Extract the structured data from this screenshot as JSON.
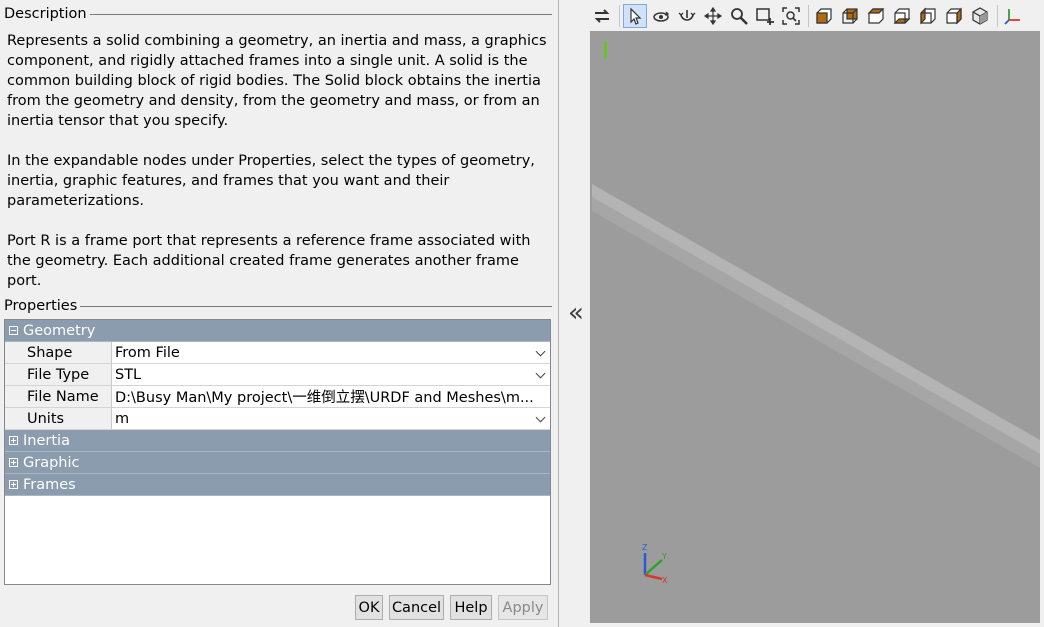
{
  "description": {
    "title": "Description",
    "paragraphs": [
      "Represents a solid combining a geometry, an inertia and mass, a graphics component, and rigidly attached frames into a single unit. A solid is the common building block of rigid bodies. The Solid block obtains the inertia from the geometry and density, from the geometry and mass, or from an inertia tensor that you specify.",
      "In the expandable nodes under Properties, select the types of geometry, inertia, graphic features, and frames that you want and their parameterizations.",
      "Port R is a frame port that represents a reference frame associated with the geometry. Each additional created frame generates another frame port."
    ]
  },
  "properties": {
    "title": "Properties",
    "geometry": {
      "label": "Geometry",
      "rows": [
        {
          "label": "Shape",
          "value": "From File"
        },
        {
          "label": "File Type",
          "value": "STL"
        },
        {
          "label": "File Name",
          "value": "D:\\Busy Man\\My project\\一维倒立摆\\URDF and Meshes\\m..."
        },
        {
          "label": "Units",
          "value": "m"
        }
      ]
    },
    "inertia": {
      "label": "Inertia"
    },
    "graphic": {
      "label": "Graphic"
    },
    "frames": {
      "label": "Frames"
    }
  },
  "buttons": {
    "ok": "OK",
    "cancel": "Cancel",
    "help": "Help",
    "apply": "Apply"
  },
  "triad": {
    "x": "X",
    "y": "Y",
    "z": "Z"
  },
  "colors": {
    "section_header": "#8a9cae",
    "viewport_background": "#9c9c9c",
    "solid_top": "#b4b4b4",
    "solid_side": "#a6a6a6",
    "active_tool": "#cfe2f7"
  },
  "toolbar_icons": [
    "swap-icon",
    "select-arrow-icon",
    "rotate-icon",
    "roll-icon",
    "pan-icon",
    "zoom-icon",
    "zoom-box-icon",
    "fit-to-view-icon",
    "front-view-icon",
    "back-view-icon",
    "left-view-icon",
    "right-view-icon",
    "top-view-icon",
    "bottom-view-icon",
    "isometric-view-icon",
    "axes-triad-icon"
  ]
}
